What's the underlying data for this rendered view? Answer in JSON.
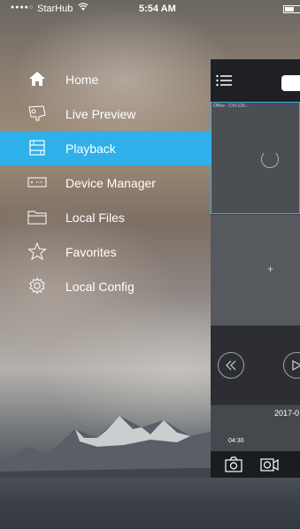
{
  "status_bar": {
    "signal": "●●●●○",
    "carrier": "StarHub",
    "time": "5:54 AM"
  },
  "menu": {
    "items": [
      {
        "label": "Home",
        "icon": "home-icon"
      },
      {
        "label": "Live Preview",
        "icon": "live-preview-icon"
      },
      {
        "label": "Playback",
        "icon": "playback-icon",
        "active": true
      },
      {
        "label": "Device Manager",
        "icon": "device-manager-icon"
      },
      {
        "label": "Local Files",
        "icon": "folder-icon"
      },
      {
        "label": "Favorites",
        "icon": "star-icon"
      },
      {
        "label": "Local Config",
        "icon": "gear-icon"
      }
    ]
  },
  "preview_panel": {
    "camera_label": "Office - CVI-120...",
    "add_symbol": "+",
    "date": "2017-0",
    "timeline_time": "04:30"
  },
  "colors": {
    "accent": "#2fb0ea",
    "panel_bg": "#3a3d42",
    "topbar_bg": "#1e2024"
  }
}
